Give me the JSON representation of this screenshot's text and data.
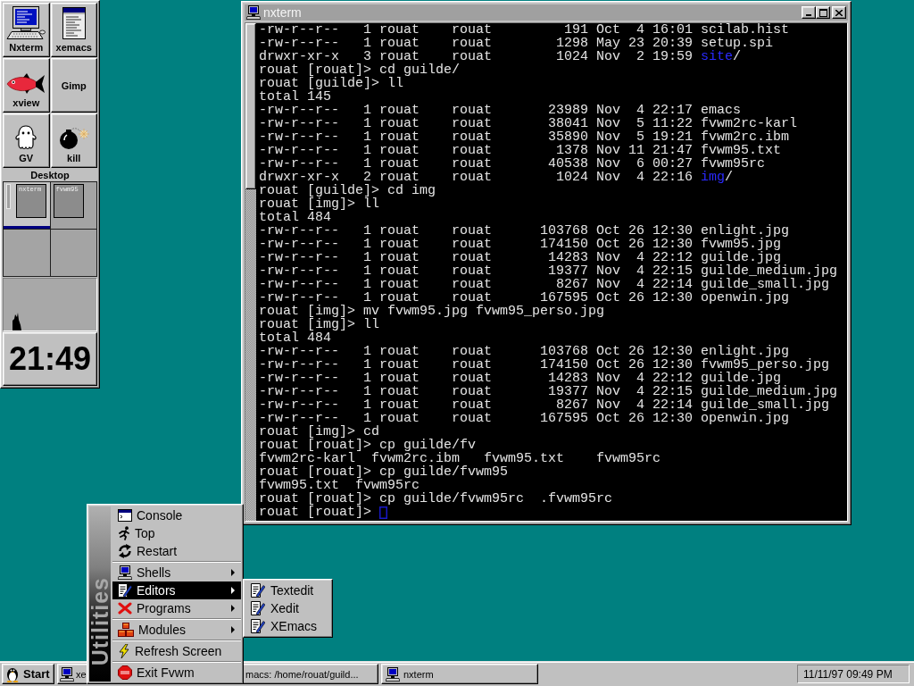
{
  "dock": {
    "launchers": [
      {
        "label": "Nxterm"
      },
      {
        "label": "xview"
      },
      {
        "label": "GV"
      },
      {
        "label": "xemacs"
      },
      {
        "label": "Gimp"
      },
      {
        "label": "kill"
      }
    ],
    "pager": {
      "title": "Desktop",
      "pages": [
        {
          "selected": true,
          "windows": [
            {
              "kind": "bar"
            },
            {
              "kind": "app",
              "label": "nxterm"
            }
          ]
        },
        {
          "selected": false,
          "windows": [
            {
              "kind": "app",
              "label": "fvwm95"
            }
          ]
        },
        {
          "selected": false
        },
        {
          "selected": false
        }
      ]
    },
    "clock": "21:49"
  },
  "terminal": {
    "title": "nxterm",
    "cursor": true,
    "lines": [
      "-rw-r--r--   1 rouat    rouat         191 Oct  4 16:01 scilab.hist",
      "-rw-r--r--   1 rouat    rouat        1298 May 23 20:39 setup.spi",
      {
        "segments": [
          {
            "kind": "plain",
            "text": "drwxr-xr-x   3 rouat    rouat        1024 Nov  2 19:59 "
          },
          {
            "kind": "dir",
            "text": "site"
          },
          {
            "kind": "plain",
            "text": "/"
          }
        ]
      },
      "rouat [rouat]> cd guilde/",
      "rouat [guilde]> ll",
      "total 145",
      "-rw-r--r--   1 rouat    rouat       23989 Nov  4 22:17 emacs",
      "-rw-r--r--   1 rouat    rouat       38041 Nov  5 11:22 fvwm2rc-karl",
      "-rw-r--r--   1 rouat    rouat       35890 Nov  5 19:21 fvwm2rc.ibm",
      "-rw-r--r--   1 rouat    rouat        1378 Nov 11 21:47 fvwm95.txt",
      "-rw-r--r--   1 rouat    rouat       40538 Nov  6 00:27 fvwm95rc",
      {
        "segments": [
          {
            "kind": "plain",
            "text": "drwxr-xr-x   2 rouat    rouat        1024 Nov  4 22:16 "
          },
          {
            "kind": "dir",
            "text": "img"
          },
          {
            "kind": "plain",
            "text": "/"
          }
        ]
      },
      "rouat [guilde]> cd img",
      "rouat [img]> ll",
      "total 484",
      "-rw-r--r--   1 rouat    rouat      103768 Oct 26 12:30 enlight.jpg",
      "-rw-r--r--   1 rouat    rouat      174150 Oct 26 12:30 fvwm95.jpg",
      "-rw-r--r--   1 rouat    rouat       14283 Nov  4 22:12 guilde.jpg",
      "-rw-r--r--   1 rouat    rouat       19377 Nov  4 22:15 guilde_medium.jpg",
      "-rw-r--r--   1 rouat    rouat        8267 Nov  4 22:14 guilde_small.jpg",
      "-rw-r--r--   1 rouat    rouat      167595 Oct 26 12:30 openwin.jpg",
      "rouat [img]> mv fvwm95.jpg fvwm95_perso.jpg",
      "rouat [img]> ll",
      "total 484",
      "-rw-r--r--   1 rouat    rouat      103768 Oct 26 12:30 enlight.jpg",
      "-rw-r--r--   1 rouat    rouat      174150 Oct 26 12:30 fvwm95_perso.jpg",
      "-rw-r--r--   1 rouat    rouat       14283 Nov  4 22:12 guilde.jpg",
      "-rw-r--r--   1 rouat    rouat       19377 Nov  4 22:15 guilde_medium.jpg",
      "-rw-r--r--   1 rouat    rouat        8267 Nov  4 22:14 guilde_small.jpg",
      "-rw-r--r--   1 rouat    rouat      167595 Oct 26 12:30 openwin.jpg",
      "rouat [img]> cd",
      "rouat [rouat]> cp guilde/fv",
      "fvwm2rc-karl  fvwm2rc.ibm   fvwm95.txt    fvwm95rc",
      "rouat [rouat]> cp guilde/fvwm95",
      "fvwm95.txt  fvwm95rc",
      "rouat [rouat]> cp guilde/fvwm95rc  .fvwm95rc",
      "rouat [rouat]> "
    ]
  },
  "menu": {
    "title": "Utilities",
    "groups": [
      {
        "items": [
          {
            "label": "Console",
            "submenu": false,
            "selected": false
          },
          {
            "label": "Top",
            "submenu": false,
            "selected": false
          },
          {
            "label": "Restart",
            "submenu": false,
            "selected": false
          }
        ]
      },
      {
        "items": [
          {
            "label": "Shells",
            "submenu": true,
            "selected": false
          },
          {
            "label": "Editors",
            "submenu": true,
            "selected": true
          },
          {
            "label": "Programs",
            "submenu": true,
            "selected": false
          }
        ]
      },
      {
        "items": [
          {
            "label": "Modules",
            "submenu": true,
            "selected": false
          }
        ]
      },
      {
        "items": [
          {
            "label": "Refresh Screen",
            "submenu": false,
            "selected": false
          }
        ]
      },
      {
        "items": [
          {
            "label": "Exit Fvwm",
            "submenu": false,
            "selected": false
          }
        ]
      }
    ]
  },
  "submenu": {
    "items": [
      {
        "label": "Textedit",
        "selected": false
      },
      {
        "label": "Xedit",
        "selected": false
      },
      {
        "label": "XEmacs",
        "selected": false
      }
    ]
  },
  "taskbar": {
    "start": "Start",
    "tasks": [
      {
        "label": "xe",
        "icon": true
      },
      {
        "label": "macs: /home/rouat/guild...",
        "icon": false
      },
      {
        "label": "nxterm",
        "icon": true
      }
    ],
    "clock": "11/11/97 09:49 PM"
  }
}
